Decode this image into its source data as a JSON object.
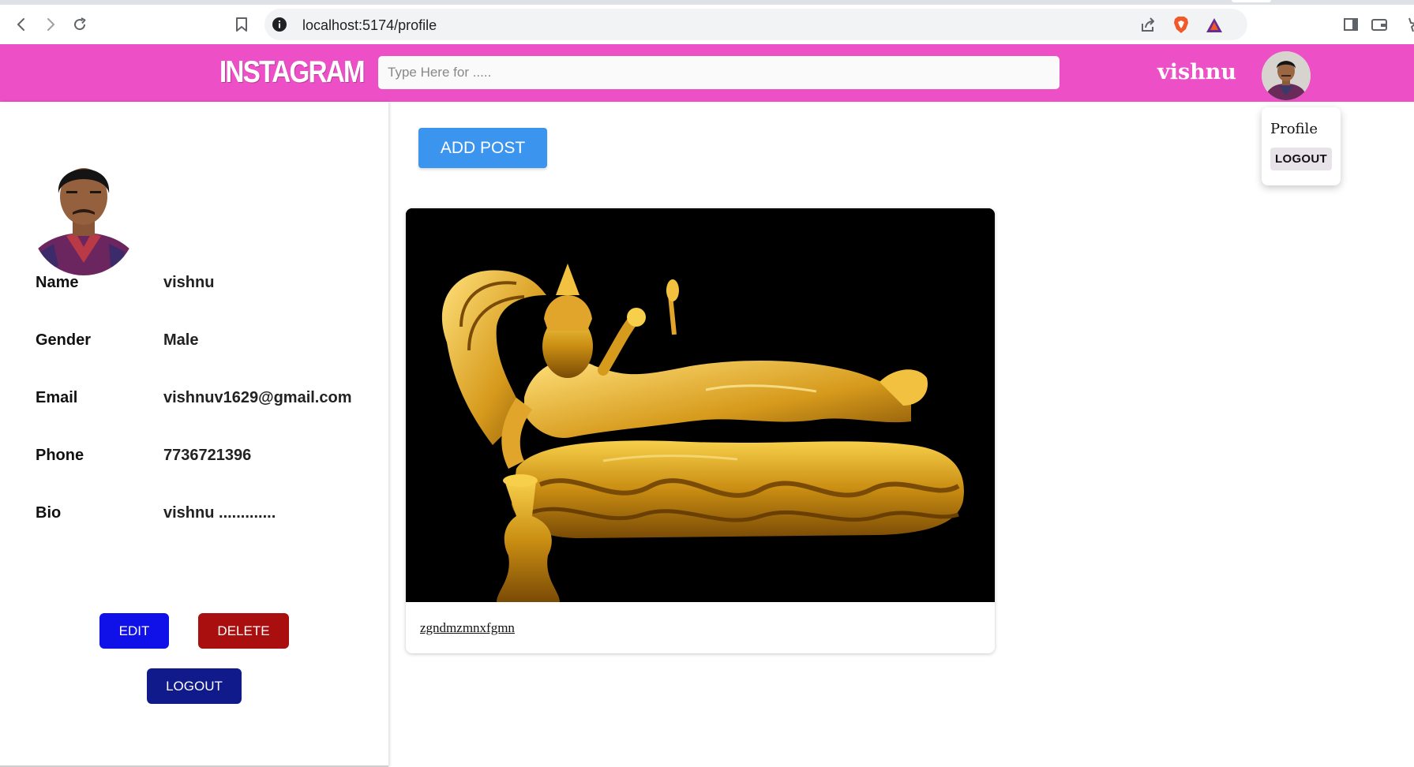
{
  "browser": {
    "url": "localhost:5174/profile",
    "icons": [
      "back-icon",
      "forward-icon",
      "reload-icon",
      "bookmark-icon",
      "info-icon",
      "share-icon",
      "brave-shield-icon",
      "brave-rewards-icon",
      "sidebar-icon",
      "wallet-icon",
      "extensions-icon"
    ]
  },
  "header": {
    "logo": "INSTAGRAM",
    "search_placeholder": "Type Here for .....",
    "username": "vishnu",
    "colors": {
      "header_bg": "#ec4fc6"
    }
  },
  "dropdown": {
    "profile_label": "Profile",
    "logout_label": "LOGOUT"
  },
  "profile": {
    "fields": [
      {
        "label": "Name",
        "value": "vishnu"
      },
      {
        "label": "Gender",
        "value": "Male"
      },
      {
        "label": "Email",
        "value": "vishnuv1629@gmail.com"
      },
      {
        "label": "Phone",
        "value": "7736721396"
      },
      {
        "label": "Bio",
        "value": "vishnu ............."
      }
    ],
    "edit_label": "EDIT",
    "delete_label": "DELETE",
    "logout_label": "LOGOUT"
  },
  "main": {
    "add_post_label": "ADD POST",
    "posts": [
      {
        "caption": "zgndmzmnxfgmn"
      }
    ]
  },
  "colors": {
    "edit": "#1010e8",
    "delete": "#a90f0f",
    "logout": "#101a8a",
    "add_post": "#3b95ee"
  }
}
